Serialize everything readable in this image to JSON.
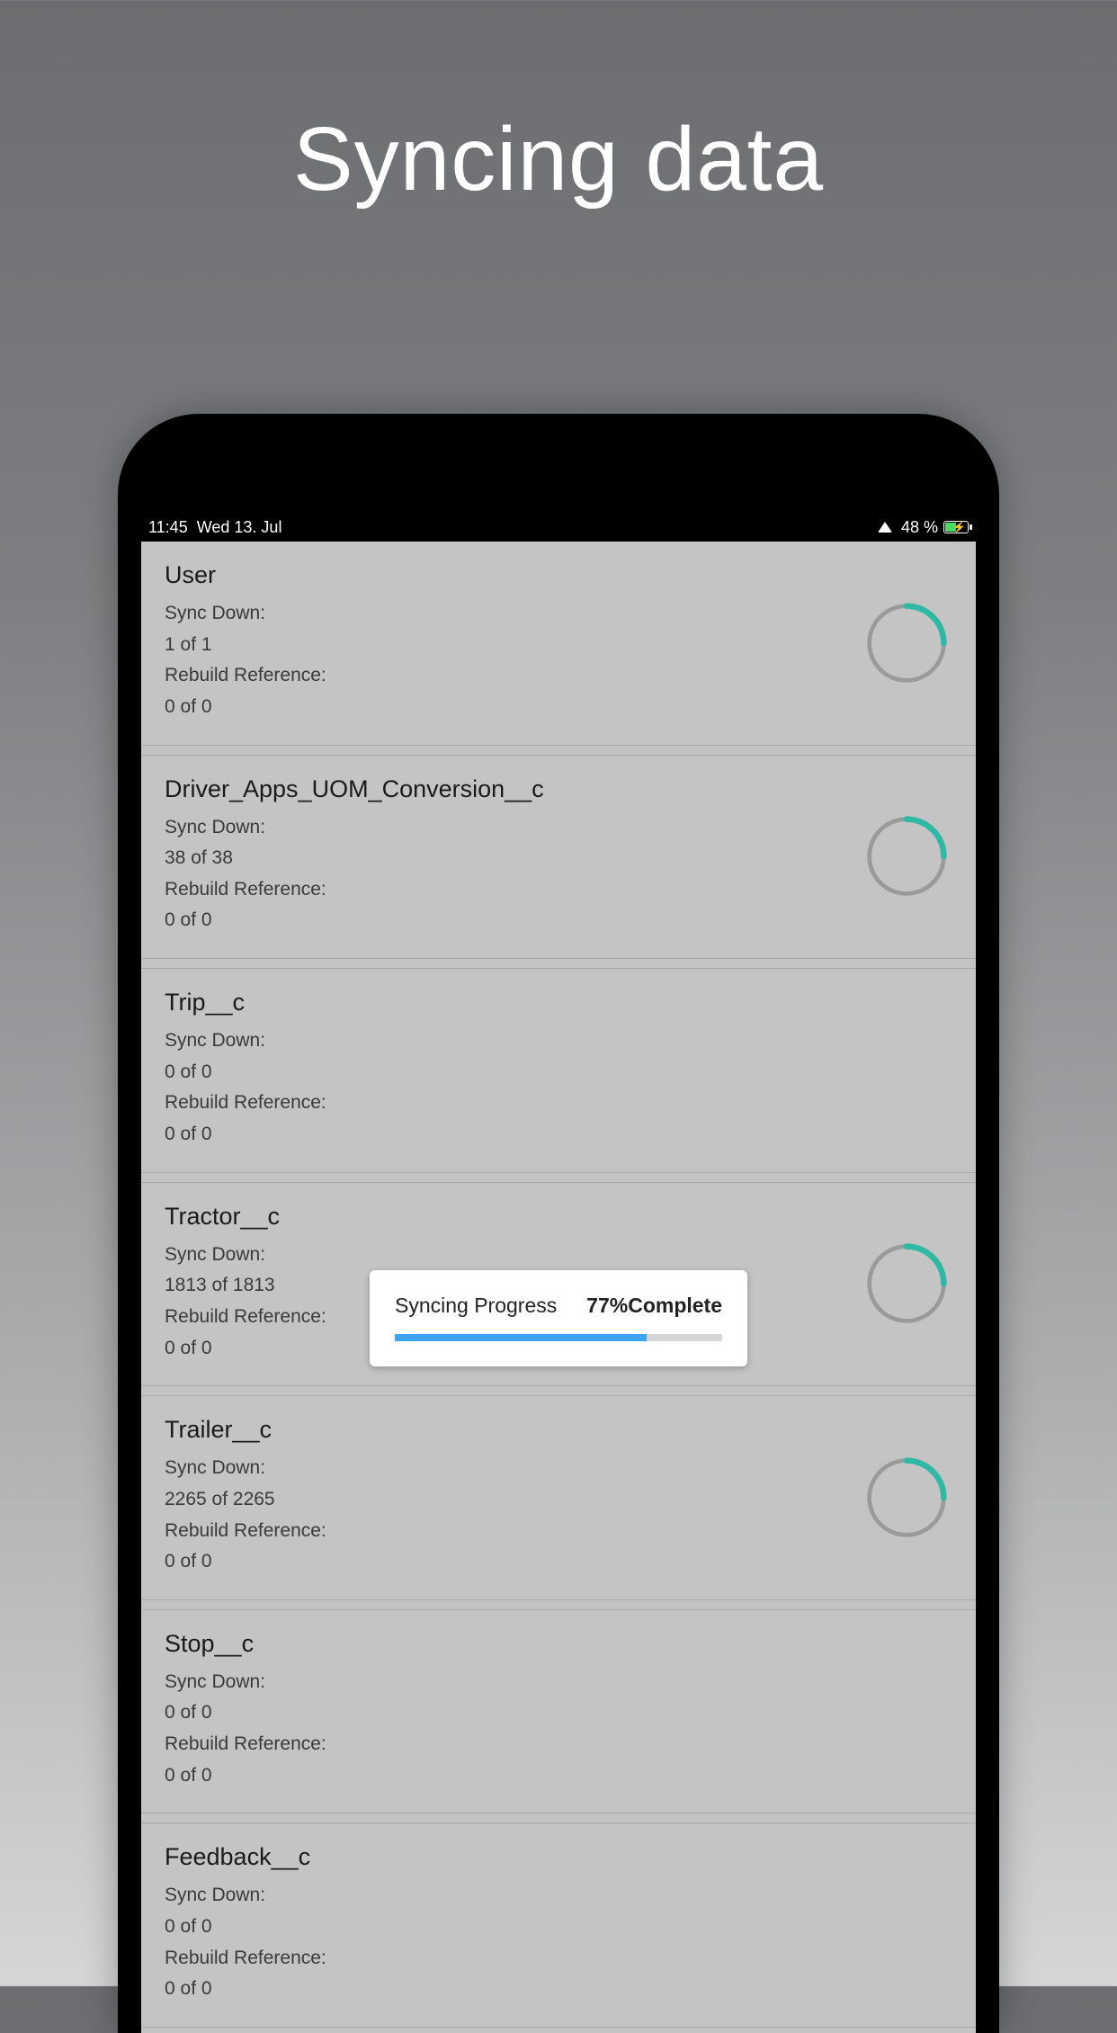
{
  "pageTitle": "Syncing data",
  "statusBar": {
    "time": "11:45",
    "date": "Wed 13. Jul",
    "batteryText": "48 %"
  },
  "labels": {
    "syncDown": "Sync Down:",
    "rebuildRef": "Rebuild Reference:"
  },
  "items": [
    {
      "name": "User",
      "syncCount": "1 of 1",
      "rebuildCount": "0 of 0",
      "spinner": true
    },
    {
      "name": "Driver_Apps_UOM_Conversion__c",
      "syncCount": "38 of 38",
      "rebuildCount": "0 of 0",
      "spinner": true
    },
    {
      "name": "Trip__c",
      "syncCount": "0 of 0",
      "rebuildCount": "0 of 0",
      "spinner": false
    },
    {
      "name": "Tractor__c",
      "syncCount": "1813 of 1813",
      "rebuildCount": "0 of 0",
      "spinner": true
    },
    {
      "name": "Trailer__c",
      "syncCount": "2265 of 2265",
      "rebuildCount": "0 of 0",
      "spinner": true
    },
    {
      "name": "Stop__c",
      "syncCount": "0 of 0",
      "rebuildCount": "0 of 0",
      "spinner": false
    },
    {
      "name": "Feedback__c",
      "syncCount": "0 of 0",
      "rebuildCount": "0 of 0",
      "spinner": false
    }
  ],
  "modal": {
    "title": "Syncing Progress",
    "percentText": "77%Complete",
    "percent": 77
  },
  "colors": {
    "spinnerAccent": "#2fb8a3",
    "spinnerTrack": "#9a9a9a",
    "progress": "#3ea3f2"
  }
}
